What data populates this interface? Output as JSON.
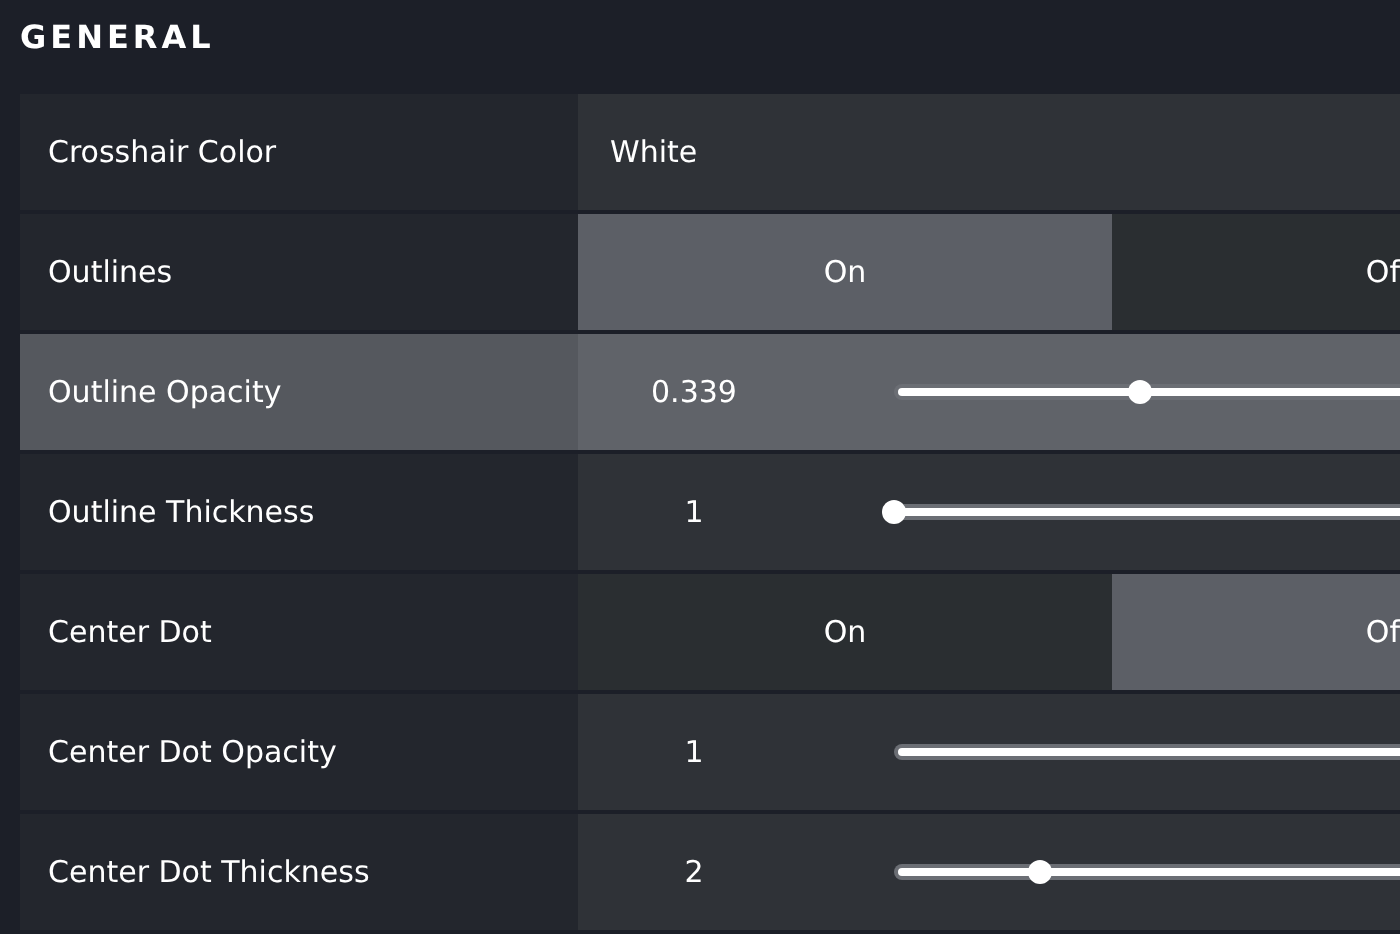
{
  "section": {
    "title": "GENERAL"
  },
  "rows": [
    {
      "kind": "text",
      "label": "Crosshair Color",
      "highlighted": false,
      "value": "White"
    },
    {
      "kind": "toggle",
      "label": "Outlines",
      "highlighted": false,
      "options": [
        {
          "label": "On",
          "selected": true
        },
        {
          "label": "Of",
          "selected": false
        }
      ]
    },
    {
      "kind": "slider",
      "label": "Outline Opacity",
      "highlighted": true,
      "value": "0.339",
      "level": 0.339
    },
    {
      "kind": "slider",
      "label": "Outline Thickness",
      "highlighted": false,
      "value": "1",
      "level": 0
    },
    {
      "kind": "toggle",
      "label": "Center Dot",
      "highlighted": false,
      "options": [
        {
          "label": "On",
          "selected": false
        },
        {
          "label": "Of",
          "selected": true
        }
      ]
    },
    {
      "kind": "slider",
      "label": "Center Dot Opacity",
      "highlighted": false,
      "value": "1",
      "level": 1
    },
    {
      "kind": "slider",
      "label": "Center Dot Thickness",
      "highlighted": false,
      "value": "2",
      "level": 0.2
    }
  ]
}
